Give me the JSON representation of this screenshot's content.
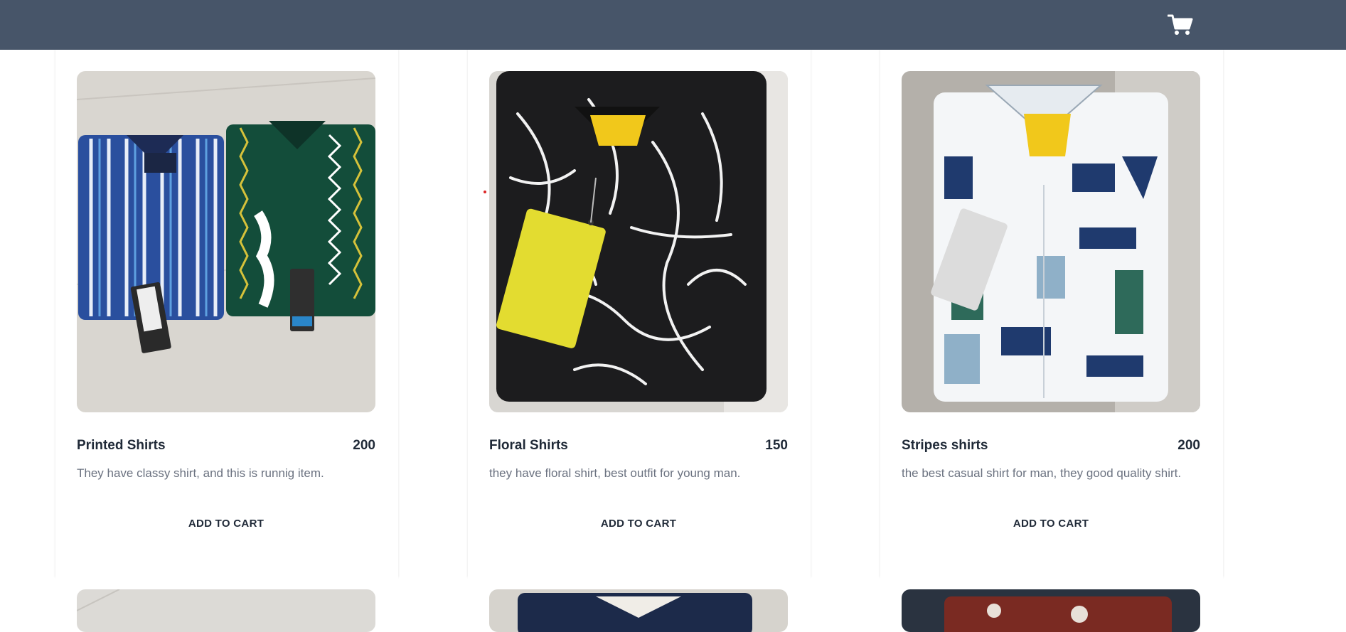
{
  "navbar": {
    "cart_icon": "shopping-cart-icon",
    "background": "#475569"
  },
  "products": [
    {
      "title": "Printed Shirts",
      "price": "200",
      "description": "They have classy shirt, and this is runnig item.",
      "button": "ADD TO CART"
    },
    {
      "title": "Floral Shirts",
      "price": "150",
      "description": "they have floral shirt, best outfit for young man.",
      "button": "ADD TO CART"
    },
    {
      "title": "Stripes shirts",
      "price": "200",
      "description": "the best casual shirt for man, they good quality shirt.",
      "button": "ADD TO CART"
    }
  ]
}
